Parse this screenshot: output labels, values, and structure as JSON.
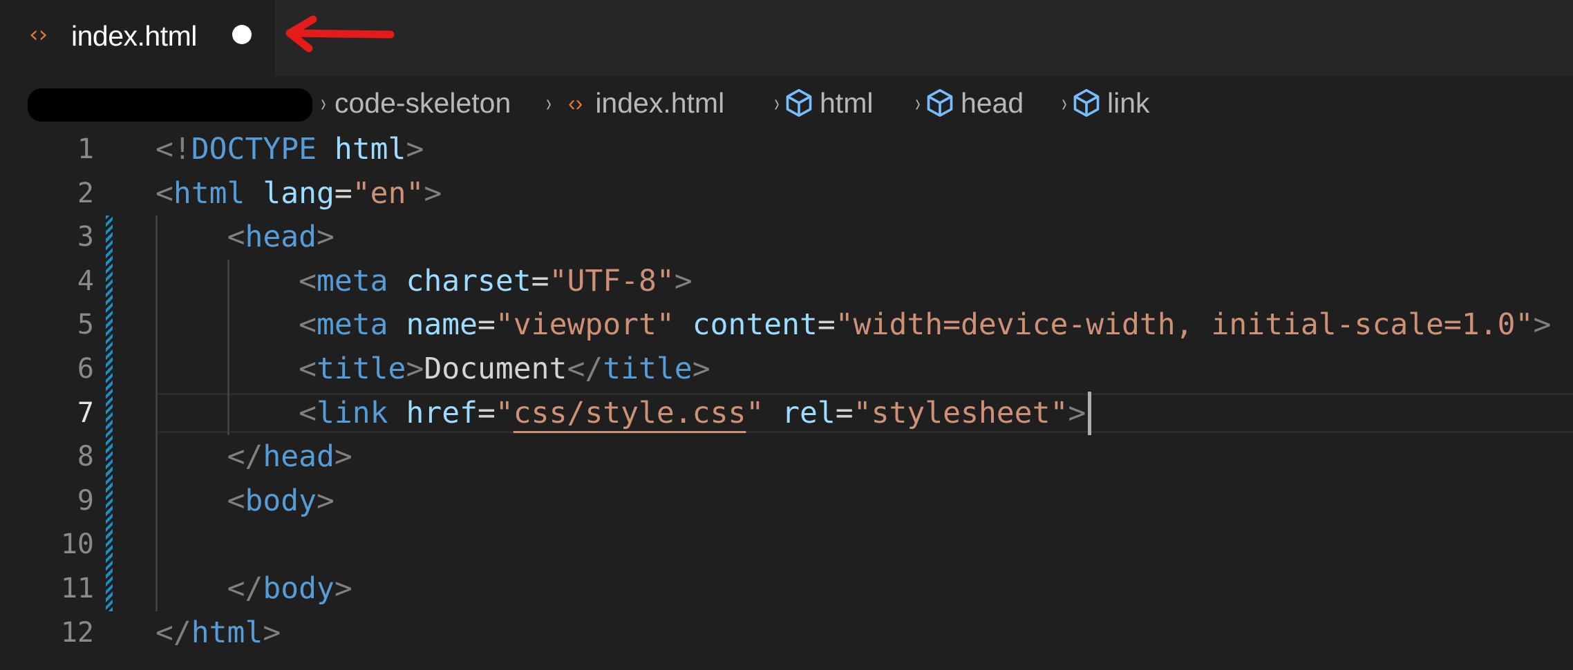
{
  "tab": {
    "icon": "code-brackets-icon",
    "icon_glyph": "‹›",
    "filename": "index.html",
    "unsaved": true
  },
  "annotation": {
    "type": "red-arrow",
    "color": "#e31b1b",
    "points_to": "unsaved-indicator"
  },
  "breadcrumb": {
    "redacted_segment": true,
    "items": [
      {
        "label": "code-skeleton",
        "icon": null
      },
      {
        "label": "index.html",
        "icon": "code-brackets-icon"
      },
      {
        "label": "html",
        "icon": "symbol-cube-icon"
      },
      {
        "label": "head",
        "icon": "symbol-cube-icon"
      },
      {
        "label": "link",
        "icon": "symbol-cube-icon"
      }
    ],
    "separator": "›"
  },
  "editor": {
    "active_line": 7,
    "added_lines_range": [
      3,
      11
    ],
    "lines": [
      {
        "n": "1",
        "tokens": [
          [
            "p",
            "<!"
          ],
          [
            "tag",
            "DOCTYPE"
          ],
          [
            "txt",
            " "
          ],
          [
            "attr",
            "html"
          ],
          [
            "p",
            ">"
          ]
        ]
      },
      {
        "n": "2",
        "tokens": [
          [
            "p",
            "<"
          ],
          [
            "tag",
            "html"
          ],
          [
            "txt",
            " "
          ],
          [
            "attr",
            "lang"
          ],
          [
            "eq",
            "="
          ],
          [
            "str",
            "\"en\""
          ],
          [
            "p",
            ">"
          ]
        ]
      },
      {
        "n": "3",
        "tokens": [
          [
            "txt",
            "    "
          ],
          [
            "p",
            "<"
          ],
          [
            "tag",
            "head"
          ],
          [
            "p",
            ">"
          ]
        ]
      },
      {
        "n": "4",
        "tokens": [
          [
            "txt",
            "        "
          ],
          [
            "p",
            "<"
          ],
          [
            "tag",
            "meta"
          ],
          [
            "txt",
            " "
          ],
          [
            "attr",
            "charset"
          ],
          [
            "eq",
            "="
          ],
          [
            "str",
            "\"UTF-8\""
          ],
          [
            "p",
            ">"
          ]
        ]
      },
      {
        "n": "5",
        "tokens": [
          [
            "txt",
            "        "
          ],
          [
            "p",
            "<"
          ],
          [
            "tag",
            "meta"
          ],
          [
            "txt",
            " "
          ],
          [
            "attr",
            "name"
          ],
          [
            "eq",
            "="
          ],
          [
            "str",
            "\"viewport\""
          ],
          [
            "txt",
            " "
          ],
          [
            "attr",
            "content"
          ],
          [
            "eq",
            "="
          ],
          [
            "str",
            "\"width=device-width, initial-scale=1.0\""
          ],
          [
            "p",
            ">"
          ]
        ]
      },
      {
        "n": "6",
        "tokens": [
          [
            "txt",
            "        "
          ],
          [
            "p",
            "<"
          ],
          [
            "tag",
            "title"
          ],
          [
            "p",
            ">"
          ],
          [
            "txt",
            "Document"
          ],
          [
            "p",
            "</"
          ],
          [
            "tag",
            "title"
          ],
          [
            "p",
            ">"
          ]
        ]
      },
      {
        "n": "7",
        "tokens": [
          [
            "txt",
            "        "
          ],
          [
            "p",
            "<"
          ],
          [
            "tag",
            "link"
          ],
          [
            "txt",
            " "
          ],
          [
            "attr",
            "href"
          ],
          [
            "eq",
            "="
          ],
          [
            "str",
            "\""
          ],
          [
            "str link-underline",
            "css/style.css"
          ],
          [
            "str",
            "\""
          ],
          [
            "txt",
            " "
          ],
          [
            "attr",
            "rel"
          ],
          [
            "eq",
            "="
          ],
          [
            "str",
            "\"stylesheet\""
          ],
          [
            "p",
            ">"
          ]
        ]
      },
      {
        "n": "8",
        "tokens": [
          [
            "txt",
            "    "
          ],
          [
            "p",
            "</"
          ],
          [
            "tag",
            "head"
          ],
          [
            "p",
            ">"
          ]
        ]
      },
      {
        "n": "9",
        "tokens": [
          [
            "txt",
            "    "
          ],
          [
            "p",
            "<"
          ],
          [
            "tag",
            "body"
          ],
          [
            "p",
            ">"
          ]
        ]
      },
      {
        "n": "10",
        "tokens": []
      },
      {
        "n": "11",
        "tokens": [
          [
            "txt",
            "    "
          ],
          [
            "p",
            "</"
          ],
          [
            "tag",
            "body"
          ],
          [
            "p",
            ">"
          ]
        ]
      },
      {
        "n": "12",
        "tokens": [
          [
            "p",
            "</"
          ],
          [
            "tag",
            "html"
          ],
          [
            "p",
            ">"
          ]
        ]
      }
    ]
  },
  "colors": {
    "background": "#1f1f1f",
    "tabbar": "#262626",
    "tag": "#569cd6",
    "attribute": "#9cdcfe",
    "string": "#ce9178",
    "punctuation": "#808080",
    "added_lines": "#1b8fc4",
    "code_icon": "#e37933",
    "symbol_icon": "#75beff"
  }
}
